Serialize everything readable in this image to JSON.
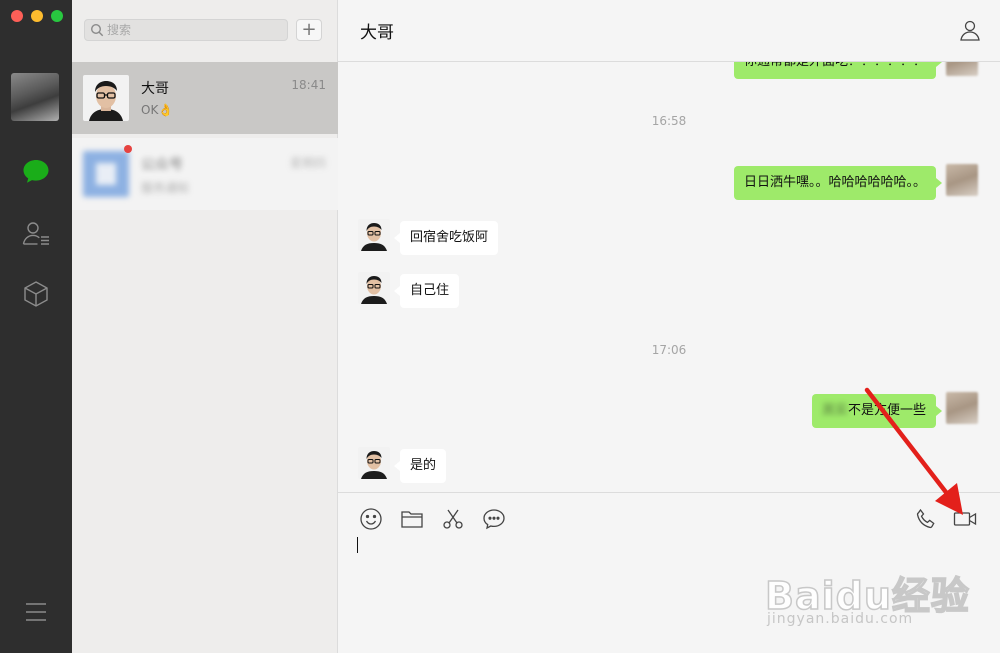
{
  "sidebar": {
    "nav": [
      {
        "icon": "chat-bubble-icon",
        "active": true
      },
      {
        "icon": "contacts-icon",
        "active": false
      },
      {
        "icon": "favorites-box-icon",
        "active": false
      }
    ],
    "menu_icon": "hamburger-menu-icon"
  },
  "chatlist": {
    "search_placeholder": "搜索",
    "add_label": "+",
    "conversations": [
      {
        "name": "大哥",
        "time": "18:41",
        "preview": "OK👌"
      },
      {
        "name": "公众号",
        "time": "星期四",
        "preview": "服务通知"
      }
    ]
  },
  "chat": {
    "title": "大哥",
    "timestamps": [
      "16:58",
      "17:06"
    ],
    "messages": [
      {
        "from": "me",
        "text": "你通常都是外面吃？？？？？？"
      },
      {
        "from": "me",
        "text": "日日洒牛嘿。。哈哈哈哈哈哈。。"
      },
      {
        "from": "them",
        "text": "回宿舍吃饭阿"
      },
      {
        "from": "them",
        "text": "自己住"
      },
      {
        "from": "me",
        "text": "不是方便一些",
        "blurred_prefix": "其实"
      },
      {
        "from": "them",
        "text": "是的"
      }
    ]
  },
  "toolbar": {
    "left": [
      "emoji-icon",
      "folder-icon",
      "screenshot-scissors-icon",
      "chat-history-icon"
    ],
    "right": [
      "voice-call-icon",
      "video-call-icon"
    ]
  },
  "colors": {
    "sidebar_bg": "#2e2e2e",
    "active_green": "#1aad19",
    "my_bubble": "#9eea6a",
    "annotation_arrow": "#e3201b"
  },
  "watermark": {
    "main": "Baidu经验",
    "url": "jingyan.baidu.com"
  }
}
